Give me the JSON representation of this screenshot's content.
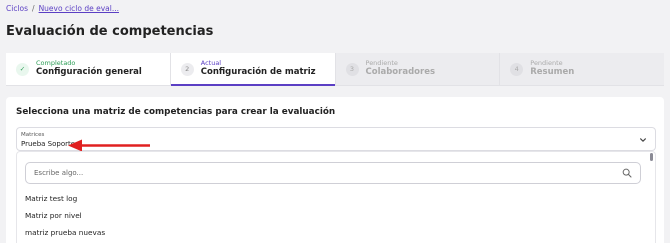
{
  "breadcrumb": {
    "root": "Ciclos",
    "separator": "/",
    "current": "Nuevo ciclo de eval..."
  },
  "page": {
    "title": "Evaluación de competencias"
  },
  "stepper": {
    "steps": [
      {
        "status": "Completado",
        "name": "Configuración general",
        "number": "✓",
        "state": "completed"
      },
      {
        "status": "Actual",
        "name": "Configuración de matriz",
        "number": "2",
        "state": "current"
      },
      {
        "status": "Pendiente",
        "name": "Colaboradores",
        "number": "3",
        "state": "pending"
      },
      {
        "status": "Pendiente",
        "name": "Resumen",
        "number": "4",
        "state": "pending"
      }
    ]
  },
  "matrix_section": {
    "heading": "Selecciona una matriz de competencias para crear la evaluación",
    "select": {
      "label": "Matrices",
      "value": "Prueba Soporte"
    },
    "dropdown": {
      "search_placeholder": "Escribe algo...",
      "options": [
        "Matriz test log",
        "Matriz por nivel",
        "matriz prueba nuevas"
      ]
    }
  },
  "colors": {
    "accent": "#5b3fc4",
    "success": "#2e9e57",
    "annotation_arrow": "#e02020"
  },
  "icons": {
    "completed_step": "check-icon",
    "select_toggle": "chevron-down-icon",
    "search": "search-icon"
  }
}
